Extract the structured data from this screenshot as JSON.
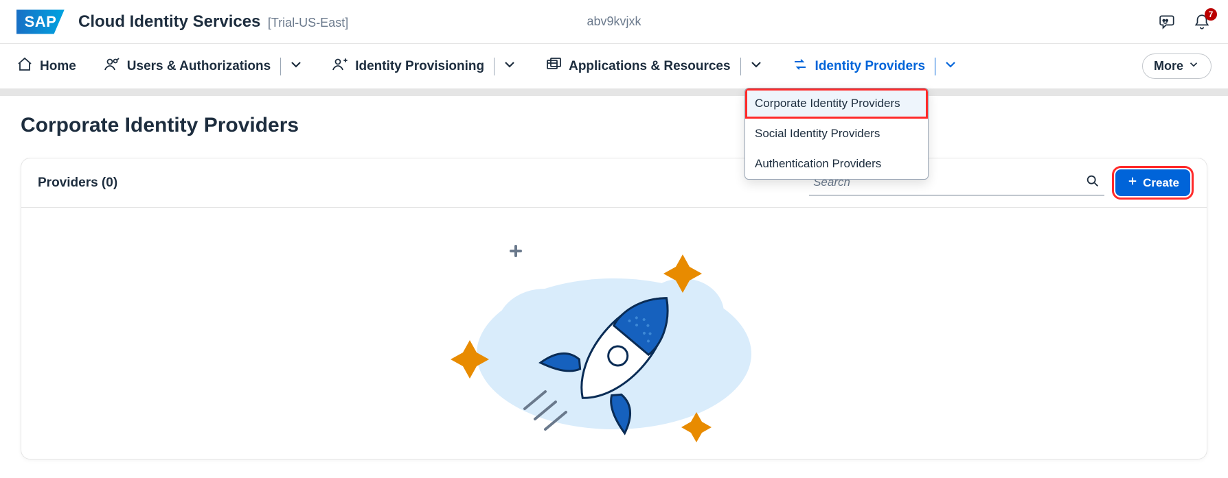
{
  "header": {
    "logo_text": "SAP",
    "app_title": "Cloud Identity Services",
    "app_subtitle": "[Trial-US-East]",
    "tenant_id": "abv9kvjxk",
    "notif_count": "7"
  },
  "nav": {
    "home": "Home",
    "users": "Users & Authorizations",
    "provisioning": "Identity Provisioning",
    "apps": "Applications & Resources",
    "idp": "Identity Providers",
    "more": "More"
  },
  "dropdown": {
    "items": [
      "Corporate Identity Providers",
      "Social Identity Providers",
      "Authentication Providers"
    ]
  },
  "page": {
    "title": "Corporate Identity Providers",
    "providers_label": "Providers (0)",
    "search_placeholder": "Search",
    "create_label": "Create"
  }
}
